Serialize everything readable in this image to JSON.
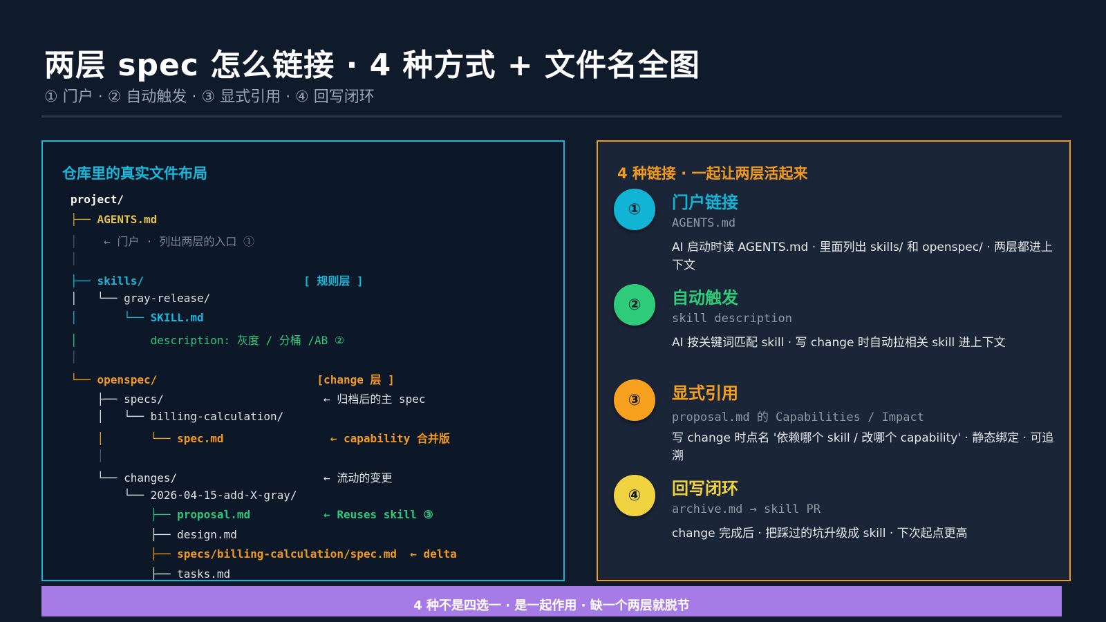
{
  "title": "两层 spec 怎么链接 · 4 种方式 + 文件名全图",
  "subtitle": "① 门户 · ② 自动触发 · ③ 显式引用 · ④ 回写闭环",
  "left_panel": {
    "heading": "仓库里的真实文件布局",
    "tree": [
      {
        "segments": [
          {
            "text": "project/",
            "color": "#ffffff",
            "bold": true
          }
        ]
      },
      {
        "segments": [
          {
            "text": "├── ",
            "color": "#d6a32a"
          },
          {
            "text": "AGENTS.md",
            "color": "#e6c14a",
            "bold": true
          }
        ]
      },
      {
        "segments": [
          {
            "text": "│    ",
            "color": "#4a5466"
          },
          {
            "text": "← 门户 · 列出两层的入口 ①",
            "color": "#7b8594"
          }
        ]
      },
      {
        "segments": [
          {
            "text": "│",
            "color": "#4a5466"
          }
        ]
      },
      {
        "segments": [
          {
            "text": "├── ",
            "color": "#1ab7d9"
          },
          {
            "text": "skills/",
            "color": "#1ab7d9",
            "bold": true
          },
          {
            "text": "                        ",
            "color": "#1ab7d9"
          },
          {
            "text": "[ 规则层 ]",
            "color": "#1ab7d9",
            "bold": true
          }
        ]
      },
      {
        "segments": [
          {
            "text": "│   └── gray-release/",
            "color": "#dfe3ea"
          }
        ]
      },
      {
        "segments": [
          {
            "text": "│       ",
            "color": "#1ab7d9"
          },
          {
            "text": "└── ",
            "color": "#1ab7d9"
          },
          {
            "text": "SKILL.md",
            "color": "#1ab7d9",
            "bold": true
          }
        ]
      },
      {
        "segments": [
          {
            "text": "│           ",
            "color": "#2fc77a"
          },
          {
            "text": "description: 灰度 / 分桶 /AB ②",
            "color": "#2fc77a"
          }
        ]
      },
      {
        "segments": [
          {
            "text": "│",
            "color": "#4a5466"
          }
        ]
      },
      {
        "segments": [
          {
            "text": "└── ",
            "color": "#f39a1c"
          },
          {
            "text": "openspec/",
            "color": "#f39a1c",
            "bold": true
          },
          {
            "text": "                        ",
            "color": "#f39a1c"
          },
          {
            "text": "[change 层 ]",
            "color": "#f39a1c",
            "bold": true
          }
        ]
      },
      {
        "segments": [
          {
            "text": "    ├── specs/                        ← 归档后的主 spec",
            "color": "#dfe3ea"
          }
        ]
      },
      {
        "segments": [
          {
            "text": "    │   └── billing-calculation/",
            "color": "#dfe3ea"
          }
        ]
      },
      {
        "segments": [
          {
            "text": "    │       ",
            "color": "#f39a1c"
          },
          {
            "text": "└── ",
            "color": "#f39a1c"
          },
          {
            "text": "spec.md",
            "color": "#f39a1c",
            "bold": true
          },
          {
            "text": "                ",
            "color": "#f39a1c"
          },
          {
            "text": "← capability 合并版",
            "color": "#f39a1c",
            "bold": true
          }
        ]
      },
      {
        "segments": [
          {
            "text": "    │",
            "color": "#4a5466"
          }
        ]
      },
      {
        "segments": [
          {
            "text": "    └── changes/                      ← 流动的变更",
            "color": "#dfe3ea"
          }
        ]
      },
      {
        "segments": [
          {
            "text": "        └── 2026-04-15-add-X-gray/",
            "color": "#dfe3ea"
          }
        ]
      },
      {
        "segments": [
          {
            "text": "            ",
            "color": "#2fc77a"
          },
          {
            "text": "├── ",
            "color": "#2fc77a"
          },
          {
            "text": "proposal.md",
            "color": "#2fc77a",
            "bold": true
          },
          {
            "text": "           ",
            "color": "#2fc77a"
          },
          {
            "text": "← Reuses skill ③",
            "color": "#2fc77a",
            "bold": true
          }
        ]
      },
      {
        "segments": [
          {
            "text": "            ├── design.md",
            "color": "#dfe3ea"
          }
        ]
      },
      {
        "segments": [
          {
            "text": "            ",
            "color": "#f39a1c"
          },
          {
            "text": "├── ",
            "color": "#f39a1c"
          },
          {
            "text": "specs/billing-calculation/spec.md",
            "color": "#f39a1c",
            "bold": true
          },
          {
            "text": "  ",
            "color": "#f39a1c"
          },
          {
            "text": "← delta",
            "color": "#f39a1c",
            "bold": true
          }
        ]
      },
      {
        "segments": [
          {
            "text": "            ├── tasks.md",
            "color": "#dfe3ea"
          }
        ]
      }
    ]
  },
  "right_panel": {
    "heading": "4 种链接 · 一起让两层活起来",
    "links": [
      {
        "num": "①",
        "color": "#12b4d6",
        "title": "门户链接",
        "file": "AGENTS.md",
        "desc": "AI 启动时读 AGENTS.md · 里面列出 skills/ 和 openspec/ · 两层都进上下文"
      },
      {
        "num": "②",
        "color": "#2ecc7a",
        "title": "自动触发",
        "file": "skill description",
        "desc": "AI 按关键词匹配 skill · 写 change 时自动拉相关 skill 进上下文"
      },
      {
        "num": "③",
        "color": "#f7a11f",
        "title": "显式引用",
        "file": "proposal.md 的 Capabilities / Impact",
        "desc": "写 change 时点名 '依赖哪个 skill / 改哪个 capability' · 静态绑定 · 可追溯"
      },
      {
        "num": "④",
        "color": "#f1d240",
        "title": "回写闭环",
        "file": "archive.md → skill PR",
        "desc": "change 完成后 · 把踩过的坑升级成 skill · 下次起点更高"
      }
    ]
  },
  "banner": "4 种不是四选一 · 是一起作用 · 缺一个两层就脱节"
}
